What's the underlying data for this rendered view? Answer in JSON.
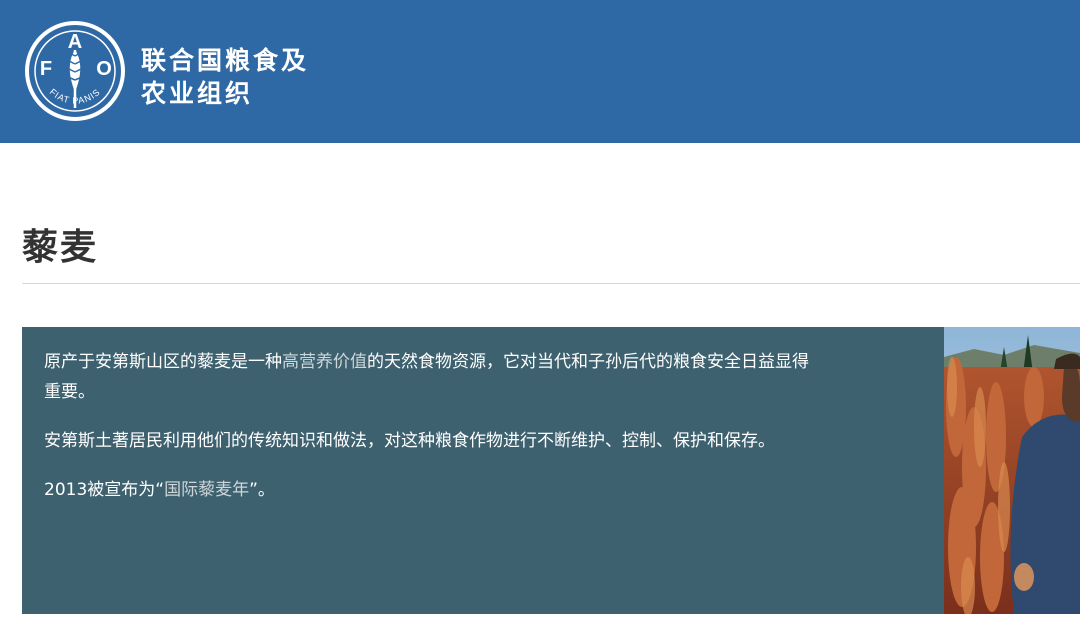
{
  "header": {
    "logo": {
      "letters": [
        "F",
        "A",
        "O"
      ],
      "motto": "FIAT PANIS",
      "icon": "fao-wheat-logo-icon"
    },
    "org_name_line1": "联合国粮食及",
    "org_name_line2": "农业组织",
    "background_color": "#2f69a5"
  },
  "page": {
    "title": "藜麦"
  },
  "panel": {
    "background_color": "#3e6170",
    "p1_before": "原产于安第斯山区的藜麦是一种",
    "p1_link": "高营养价值",
    "p1_after": "的天然食物资源，它对当代和子孙后代的粮食安全日益显得重要。",
    "p2": "安第斯土著居民利用他们的传统知识和做法，对这种粮食作物进行不断维护、控制、保护和保存。",
    "p3_before": "2013被宣布为“",
    "p3_link": "国际藜麦年",
    "p3_after": "”。"
  },
  "photo": {
    "subject": "quinoa-field-farmer-photo"
  }
}
